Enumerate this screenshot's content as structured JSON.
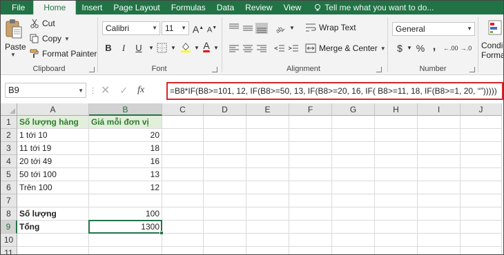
{
  "ribbon_tabs": [
    "File",
    "Home",
    "Insert",
    "Page Layout",
    "Formulas",
    "Data",
    "Review",
    "View"
  ],
  "tell_me": "Tell me what you want to do...",
  "clipboard": {
    "paste": "Paste",
    "cut": "Cut",
    "copy": "Copy",
    "format_painter": "Format Painter",
    "group_label": "Clipboard"
  },
  "font": {
    "name": "Calibri",
    "size": "11",
    "group_label": "Font",
    "bold": "B",
    "italic": "I",
    "underline": "U"
  },
  "alignment": {
    "wrap_text": "Wrap Text",
    "merge_center": "Merge & Center",
    "group_label": "Alignment"
  },
  "number": {
    "format": "General",
    "currency": "$",
    "percent": "%",
    "comma": ",",
    "increase_decimal": ".00",
    "group_label": "Number"
  },
  "styles": {
    "conditional_line1": "Condi",
    "conditional_line2": "Forma"
  },
  "formula_bar": {
    "name_box": "B9",
    "fx": "fx",
    "formula": "=B8*IF(B8>=101, 12, IF(B8>=50, 13, IF(B8>=20, 16, IF( B8>=11, 18, IF(B8>=1, 20, “”)))))"
  },
  "grid": {
    "columns": [
      "A",
      "B",
      "C",
      "D",
      "E",
      "F",
      "G",
      "H",
      "I",
      "J"
    ],
    "rows": [
      "1",
      "2",
      "3",
      "4",
      "5",
      "6",
      "7",
      "8",
      "9",
      "10",
      "11"
    ],
    "cells": {
      "A1": "Số lượng hàng",
      "B1": "Giá mỗi đơn vị",
      "A2": "1 tới 10",
      "B2": "20",
      "A3": "11 tới 19",
      "B3": "18",
      "A4": "20 tới 49",
      "B4": "16",
      "A5": "50 tới 100",
      "B5": "13",
      "A6": "Trên 100",
      "B6": "12",
      "A8": "Số lượng",
      "B8": "100",
      "A9": "Tổng",
      "B9": "1300"
    },
    "selected_cell": "B9",
    "header_fill_color": "#e2efda",
    "header_text_color": "#2e7d32"
  },
  "colors": {
    "brand": "#217346",
    "highlight_border": "#d9252a"
  }
}
